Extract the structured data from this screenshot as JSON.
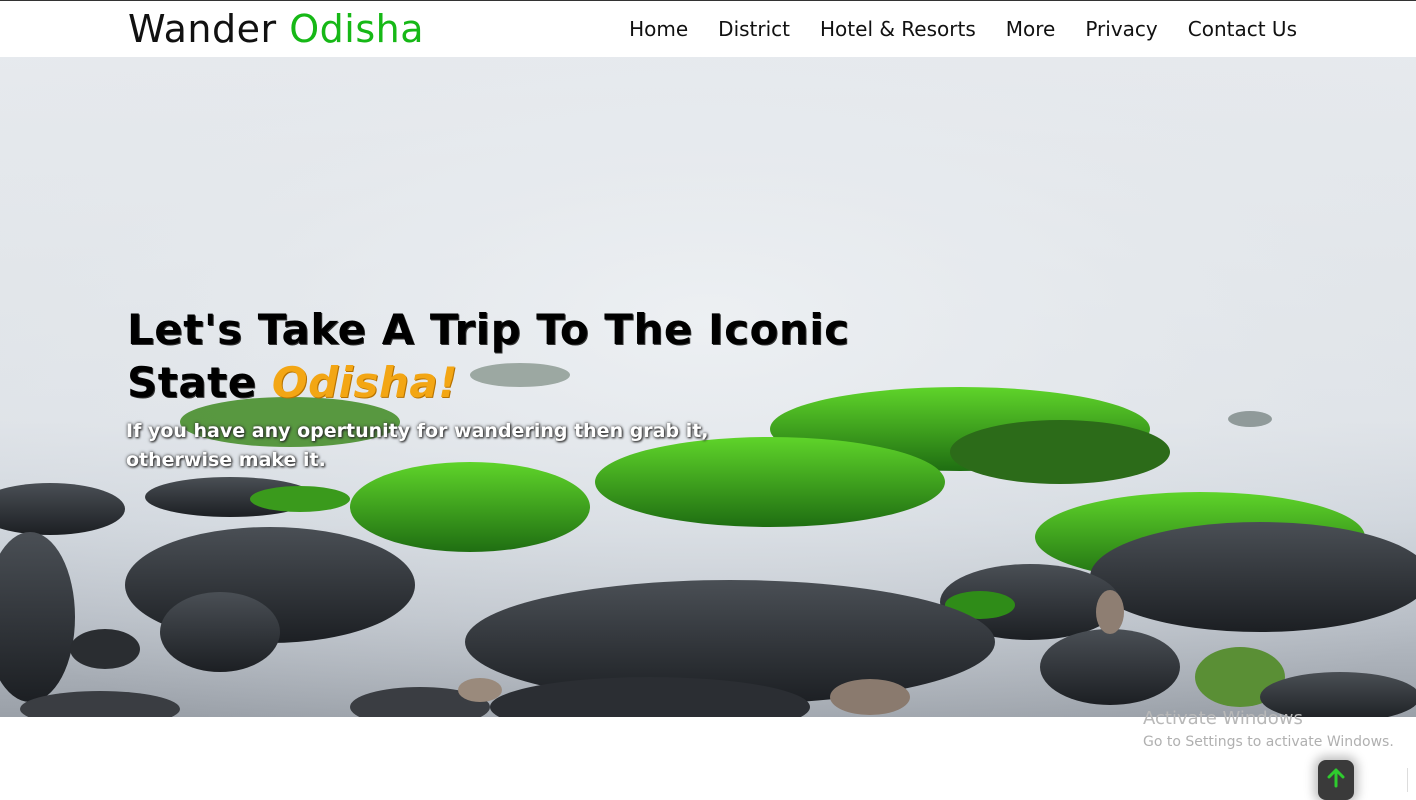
{
  "brand": {
    "name_part1": "Wander",
    "name_part2": "Odisha",
    "accent_color": "#16b816"
  },
  "nav": {
    "items": [
      {
        "label": "Home"
      },
      {
        "label": "District"
      },
      {
        "label": "Hotel & Resorts"
      },
      {
        "label": "More"
      },
      {
        "label": "Privacy"
      },
      {
        "label": "Contact Us"
      }
    ]
  },
  "hero": {
    "title_line1": "Let's Take A Trip To The Iconic",
    "title_line2_prefix": "State",
    "title_highlight": "Odisha!",
    "highlight_color": "#f3a614",
    "subtitle_line1": "If you have any opertunity for wandering then grab it,",
    "subtitle_line2": "otherwise make it."
  },
  "watermark": {
    "title": "Activate Windows",
    "subtitle": "Go to Settings to activate Windows."
  },
  "scroll_top": {
    "icon": "arrow-up-icon"
  }
}
